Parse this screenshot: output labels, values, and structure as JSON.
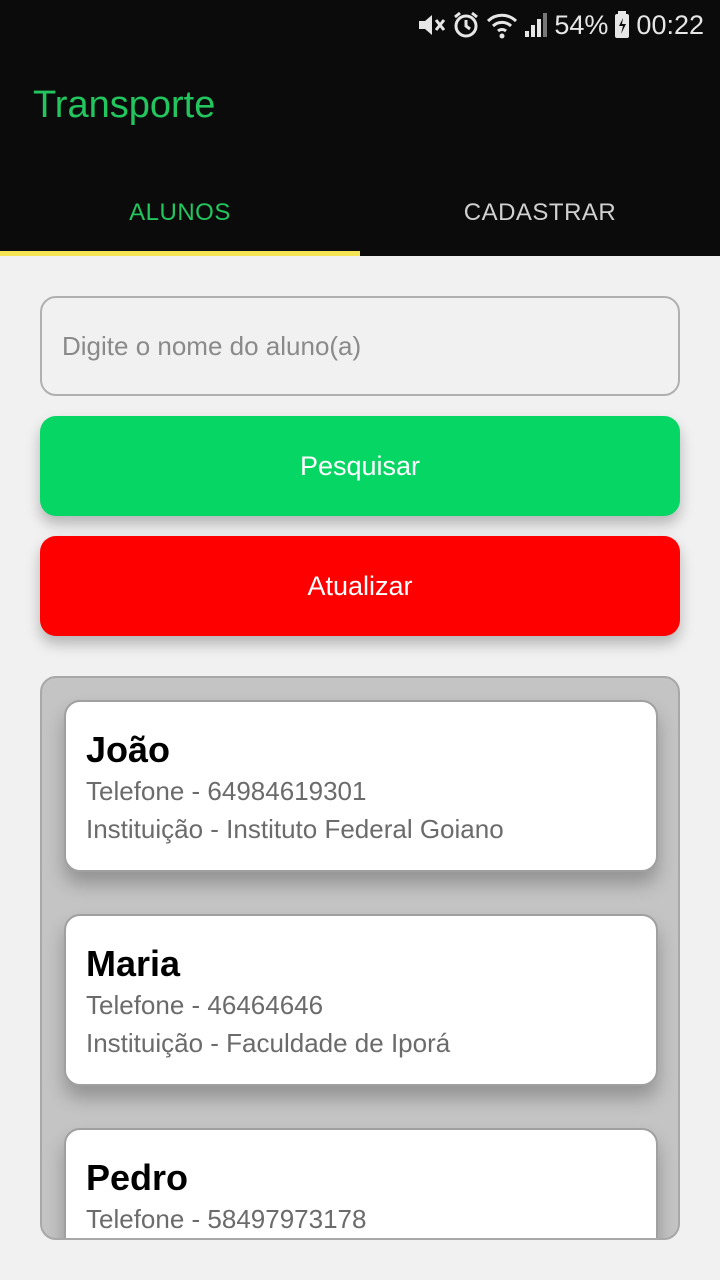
{
  "status_bar": {
    "battery": "54%",
    "time": "00:22",
    "icons": [
      "mute-icon",
      "alarm-icon",
      "wifi-icon",
      "signal-icon",
      "battery-icon"
    ]
  },
  "app": {
    "title": "Transporte",
    "accent_color": "#22c55e"
  },
  "tabs": [
    {
      "label": "ALUNOS",
      "active": true
    },
    {
      "label": "CADASTRAR",
      "active": false
    }
  ],
  "search": {
    "placeholder": "Digite o nome do aluno(a)",
    "value": ""
  },
  "buttons": {
    "search_label": "Pesquisar",
    "search_color": "#06d664",
    "refresh_label": "Atualizar",
    "refresh_color": "#ff0000"
  },
  "students": [
    {
      "name": "João",
      "phone": "Telefone - 64984619301",
      "institution": "Instituição - Instituto Federal Goiano"
    },
    {
      "name": "Maria",
      "phone": "Telefone - 46464646",
      "institution": "Instituição - Faculdade de Iporá"
    },
    {
      "name": "Pedro",
      "phone": "Telefone - 58497973178",
      "institution": ""
    }
  ]
}
